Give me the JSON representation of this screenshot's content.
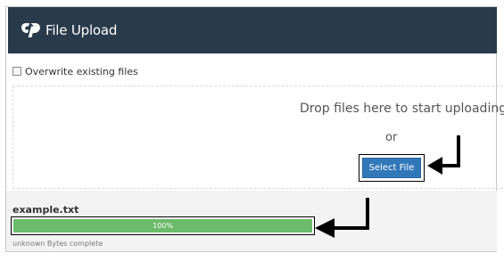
{
  "header": {
    "title": "File Upload",
    "logo_icon": "cpanel-logo-icon",
    "background": "#293a4a"
  },
  "options": {
    "overwrite_label": "Overwrite existing files",
    "overwrite_checked": false
  },
  "dropzone": {
    "instruction": "Drop files here to start uploading",
    "or_text": "or",
    "select_button_label": "Select File",
    "button_color": "#3178b9"
  },
  "upload": {
    "file_name": "example.txt",
    "progress_percent": 100,
    "progress_label": "100%",
    "progress_color": "#6bbb6b",
    "status_text": "unknown Bytes complete"
  },
  "annotations": {
    "arrow_icons": [
      "arrow-left-icon",
      "arrow-left-icon"
    ]
  }
}
